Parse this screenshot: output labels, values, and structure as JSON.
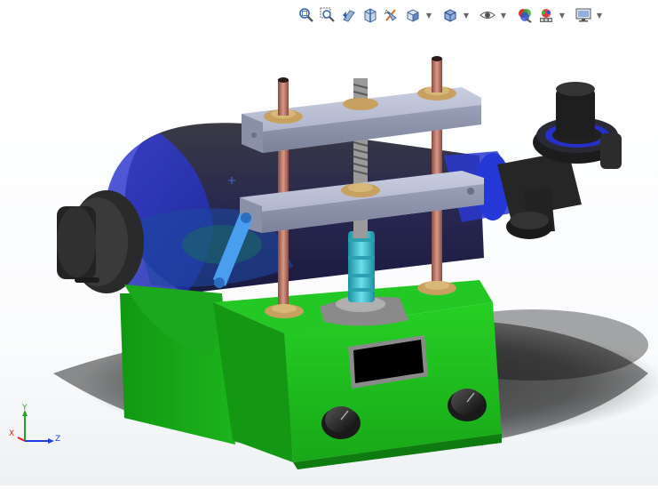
{
  "hud_toolbar": {
    "items": [
      {
        "name": "zoom-to-fit-icon"
      },
      {
        "name": "zoom-to-area-icon"
      },
      {
        "name": "previous-view-icon"
      },
      {
        "name": "section-view-icon"
      },
      {
        "name": "dynamic-annotation-views-icon"
      },
      {
        "name": "view-orientation-icon",
        "dropdown": true
      },
      {
        "name": "display-style-icon",
        "dropdown": true
      },
      {
        "name": "hide-show-items-icon",
        "dropdown": true
      },
      {
        "name": "edit-appearance-icon"
      },
      {
        "name": "apply-scene-icon",
        "dropdown": true
      },
      {
        "name": "view-settings-icon",
        "dropdown": true
      }
    ]
  },
  "triad": {
    "x_label": "X",
    "y_label": "Y",
    "z_label": "Z",
    "x_color": "#e02020",
    "y_color": "#2aa02a",
    "z_color": "#2040e0"
  },
  "model_colors": {
    "base": "#22c020",
    "drum": "#2c2c80",
    "plates": "#a8aec4",
    "rods": "#c07868",
    "knobs": "#1a1a1a",
    "screen": "#000000",
    "spindle": "#40c8d0",
    "arm": "#4a9ef0"
  }
}
